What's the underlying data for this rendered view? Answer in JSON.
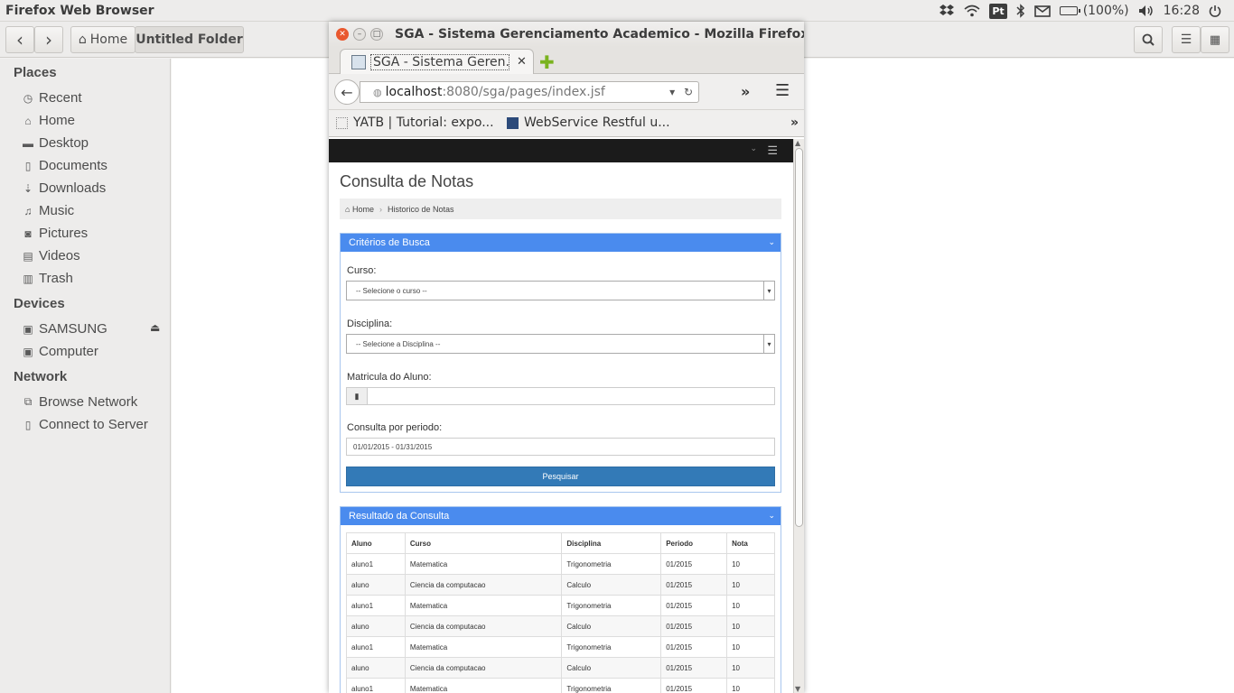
{
  "top_panel": {
    "app_name": "Firefox Web Browser",
    "pt_label": "Pt",
    "battery": "(100%)",
    "clock": "16:28"
  },
  "file_manager": {
    "nav_back": "‹",
    "nav_forward": "›",
    "path_home": "Home",
    "path_current": "Untitled Folder",
    "sidebar": {
      "places_heading": "Places",
      "places": [
        {
          "label": "Recent",
          "icon": "clock-icon"
        },
        {
          "label": "Home",
          "icon": "home-icon"
        },
        {
          "label": "Desktop",
          "icon": "folder-icon"
        },
        {
          "label": "Documents",
          "icon": "document-icon"
        },
        {
          "label": "Downloads",
          "icon": "download-icon"
        },
        {
          "label": "Music",
          "icon": "music-icon"
        },
        {
          "label": "Pictures",
          "icon": "camera-icon"
        },
        {
          "label": "Videos",
          "icon": "film-icon"
        },
        {
          "label": "Trash",
          "icon": "trash-icon"
        }
      ],
      "devices_heading": "Devices",
      "devices": [
        {
          "label": "SAMSUNG",
          "icon": "drive-icon"
        },
        {
          "label": "Computer",
          "icon": "drive-icon"
        }
      ],
      "network_heading": "Network",
      "network": [
        {
          "label": "Browse Network",
          "icon": "network-icon"
        },
        {
          "label": "Connect to Server",
          "icon": "server-icon"
        }
      ]
    }
  },
  "firefox": {
    "window_title": "SGA - Sistema Gerenciamento Academico - Mozilla Firefox",
    "tab_title": "SGA - Sistema Geren...",
    "url_host": "localhost",
    "url_path": ":8080/sga/pages/index.jsf",
    "bookmarks": [
      {
        "label": "YATB | Tutorial: expo..."
      },
      {
        "label": "WebService Restful u..."
      }
    ]
  },
  "page": {
    "title": "Consulta de Notas",
    "breadcrumb": {
      "home": "Home",
      "current": "Historico de Notas"
    },
    "search_panel": {
      "title": "Critérios de Busca",
      "curso_label": "Curso:",
      "curso_value": "-- Selecione o curso --",
      "disciplina_label": "Disciplina:",
      "disciplina_value": "-- Selecione a Disciplina --",
      "matricula_label": "Matricula do Aluno:",
      "matricula_value": "",
      "periodo_label": "Consulta por periodo:",
      "periodo_value": "01/01/2015 - 01/31/2015",
      "search_button": "Pesquisar"
    },
    "results_panel": {
      "title": "Resultado da Consulta",
      "columns": [
        "Aluno",
        "Curso",
        "Disciplina",
        "Periodo",
        "Nota"
      ],
      "rows": [
        [
          "aluno1",
          "Matematica",
          "Trigonometria",
          "01/2015",
          "10"
        ],
        [
          "aluno",
          "Ciencia da computacao",
          "Calculo",
          "01/2015",
          "10"
        ],
        [
          "aluno1",
          "Matematica",
          "Trigonometria",
          "01/2015",
          "10"
        ],
        [
          "aluno",
          "Ciencia da computacao",
          "Calculo",
          "01/2015",
          "10"
        ],
        [
          "aluno1",
          "Matematica",
          "Trigonometria",
          "01/2015",
          "10"
        ],
        [
          "aluno",
          "Ciencia da computacao",
          "Calculo",
          "01/2015",
          "10"
        ],
        [
          "aluno1",
          "Matematica",
          "Trigonometria",
          "01/2015",
          "10"
        ]
      ]
    }
  }
}
